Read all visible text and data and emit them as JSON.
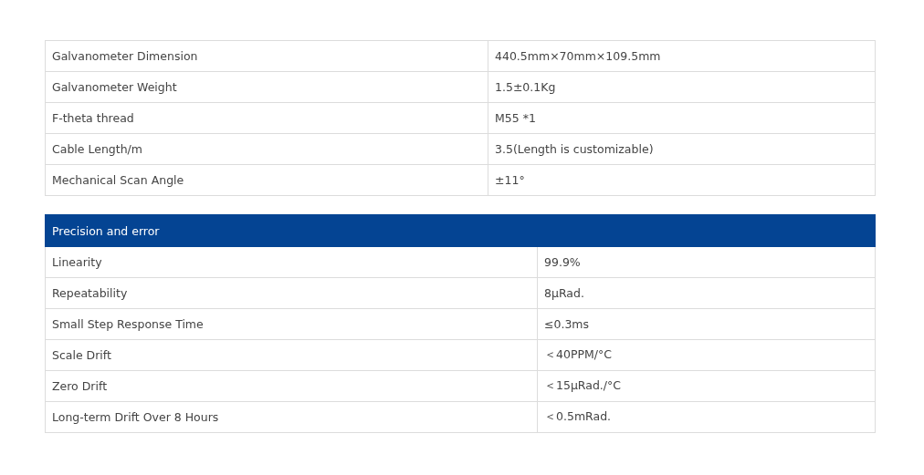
{
  "tables": [
    {
      "rows": [
        {
          "label": "Galvanometer Dimension",
          "value": "440.5mm×70mm×109.5mm"
        },
        {
          "label": "Galvanometer Weight",
          "value": "1.5±0.1Kg"
        },
        {
          "label": "F-theta thread",
          "value": "M55 *1"
        },
        {
          "label": "Cable Length/m",
          "value": "3.5(Length is customizable)"
        },
        {
          "label": "Mechanical Scan Angle",
          "value": "±11°"
        }
      ]
    },
    {
      "title": "Precision and error",
      "rows": [
        {
          "label": "Linearity",
          "value": "99.9%"
        },
        {
          "label": "Repeatability",
          "value": "8μRad."
        },
        {
          "label": "Small Step Response Time",
          "value": "≤0.3ms"
        },
        {
          "label": "Scale Drift",
          "value": "＜40PPM/°C"
        },
        {
          "label": "Zero Drift",
          "value": "＜15μRad./°C"
        },
        {
          "label": "Long-term Drift Over 8 Hours",
          "value": "＜0.5mRad."
        }
      ]
    }
  ]
}
